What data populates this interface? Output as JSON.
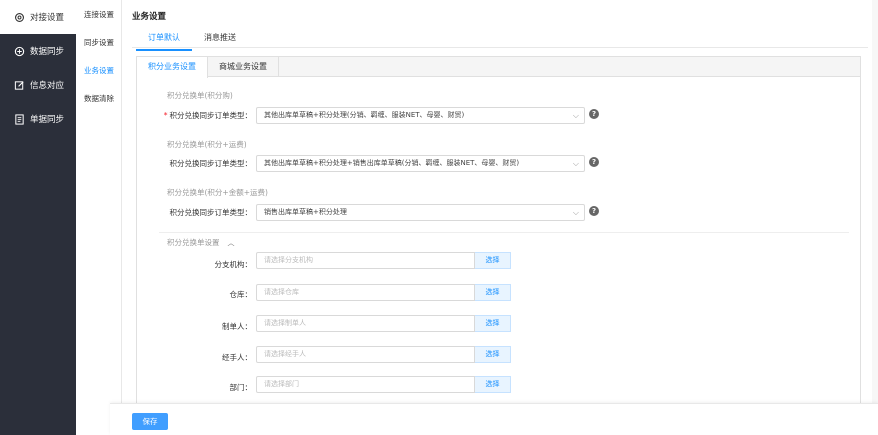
{
  "sidebar": {
    "items": [
      {
        "label": "对接设置",
        "icon": "gear-icon"
      },
      {
        "label": "数据同步",
        "icon": "sync-icon"
      },
      {
        "label": "信息对应",
        "icon": "edit-icon"
      },
      {
        "label": "单据同步",
        "icon": "document-icon"
      }
    ]
  },
  "submenu": {
    "items": [
      "连接设置",
      "同步设置",
      "业务设置",
      "数据清除"
    ]
  },
  "main": {
    "title": "业务设置",
    "tabs": [
      "订单默认",
      "消息推送"
    ],
    "inner_tabs": [
      "积分业务设置",
      "商城业务设置"
    ],
    "sections": [
      {
        "heading": "积分兑换单(积分购)",
        "label": "积分兑换同步订单类型：",
        "required": "*",
        "value": "其他出库单草稿+积分处理(分销、羁缠、服装NET、母婴、财贸)"
      },
      {
        "heading": "积分兑换单(积分+运费)",
        "label": "积分兑换同步订单类型：",
        "value": "其他出库单草稿+积分处理+销售出库单草稿(分销、羁缠、服装NET、母婴、财贸)"
      },
      {
        "heading": "积分兑换单(积分+金额+运费)",
        "label": "积分兑换同步订单类型：",
        "value": "销售出库单草稿+积分处理"
      }
    ],
    "settings_heading": "积分兑换单设置",
    "fields": [
      {
        "label": "分支机构：",
        "placeholder": "请选择分支机构",
        "button": "选择"
      },
      {
        "label": "仓库：",
        "placeholder": "请选择仓库",
        "button": "选择"
      },
      {
        "label": "制单人：",
        "placeholder": "请选择制单人",
        "button": "选择"
      },
      {
        "label": "经手人：",
        "placeholder": "请选择经手人",
        "button": "选择"
      },
      {
        "label": "部门：",
        "placeholder": "请选择部门",
        "button": "选择"
      }
    ],
    "help": "?",
    "collapse": "︿"
  },
  "footer": {
    "save_label": "保存"
  },
  "colors": {
    "sidebar_bg": "#2b2f3a",
    "accent": "#1890ff",
    "save_bg": "#409eff"
  }
}
